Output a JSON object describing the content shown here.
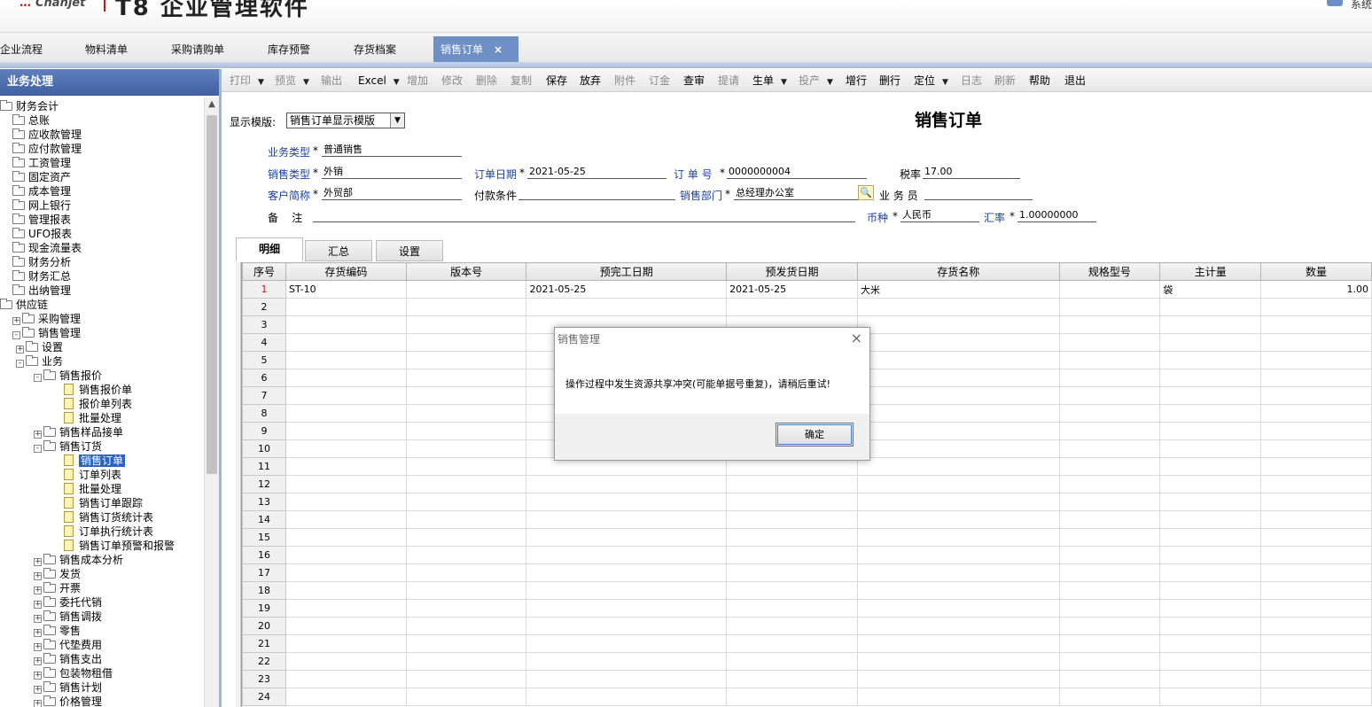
{
  "header": {
    "brand_prefix": "…",
    "brand": "Chanjet",
    "title": "T8 企业管理软件",
    "user_text": "系统"
  },
  "tabs": [
    {
      "label": "企业流程"
    },
    {
      "label": "物料清单"
    },
    {
      "label": "采购请购单"
    },
    {
      "label": "库存预警"
    },
    {
      "label": "存货档案"
    },
    {
      "label": "销售订单",
      "active": true,
      "close": "×"
    }
  ],
  "left_panel": {
    "title": "业务处理",
    "tree": [
      {
        "label": "财务会计",
        "level": 0,
        "exp": "",
        "icon": "folder"
      },
      {
        "label": "总账",
        "level": 1,
        "exp": "",
        "icon": "folder"
      },
      {
        "label": "应收款管理",
        "level": 1,
        "exp": "",
        "icon": "folder"
      },
      {
        "label": "应付款管理",
        "level": 1,
        "exp": "",
        "icon": "folder"
      },
      {
        "label": "工资管理",
        "level": 1,
        "exp": "",
        "icon": "folder"
      },
      {
        "label": "固定资产",
        "level": 1,
        "exp": "",
        "icon": "folder"
      },
      {
        "label": "成本管理",
        "level": 1,
        "exp": "",
        "icon": "folder"
      },
      {
        "label": "网上银行",
        "level": 1,
        "exp": "",
        "icon": "folder"
      },
      {
        "label": "管理报表",
        "level": 1,
        "exp": "",
        "icon": "folder"
      },
      {
        "label": "UFO报表",
        "level": 1,
        "exp": "",
        "icon": "folder"
      },
      {
        "label": "现金流量表",
        "level": 1,
        "exp": "",
        "icon": "folder"
      },
      {
        "label": "财务分析",
        "level": 1,
        "exp": "",
        "icon": "folder"
      },
      {
        "label": "财务汇总",
        "level": 1,
        "exp": "",
        "icon": "folder"
      },
      {
        "label": "出纳管理",
        "level": 1,
        "exp": "",
        "icon": "folder"
      },
      {
        "label": "供应链",
        "level": 0,
        "exp": "",
        "icon": "folder"
      },
      {
        "label": "采购管理",
        "level": 1,
        "exp": "+",
        "icon": "folder"
      },
      {
        "label": "销售管理",
        "level": 1,
        "exp": "-",
        "icon": "folder"
      },
      {
        "label": "设置",
        "level": 2,
        "exp": "+",
        "icon": "folder"
      },
      {
        "label": "业务",
        "level": 2,
        "exp": "-",
        "icon": "folder"
      },
      {
        "label": "销售报价",
        "level": 3,
        "exp": "-",
        "icon": "folder"
      },
      {
        "label": "销售报价单",
        "level": 4,
        "exp": "",
        "icon": "doc"
      },
      {
        "label": "报价单列表",
        "level": 4,
        "exp": "",
        "icon": "doc"
      },
      {
        "label": "批量处理",
        "level": 4,
        "exp": "",
        "icon": "doc"
      },
      {
        "label": "销售样品接单",
        "level": 3,
        "exp": "+",
        "icon": "folder"
      },
      {
        "label": "销售订货",
        "level": 3,
        "exp": "-",
        "icon": "folder"
      },
      {
        "label": "销售订单",
        "level": 4,
        "exp": "",
        "icon": "doc",
        "selected": true
      },
      {
        "label": "订单列表",
        "level": 4,
        "exp": "",
        "icon": "doc"
      },
      {
        "label": "批量处理",
        "level": 4,
        "exp": "",
        "icon": "doc"
      },
      {
        "label": "销售订单跟踪",
        "level": 4,
        "exp": "",
        "icon": "doc"
      },
      {
        "label": "销售订货统计表",
        "level": 4,
        "exp": "",
        "icon": "doc"
      },
      {
        "label": "订单执行统计表",
        "level": 4,
        "exp": "",
        "icon": "doc"
      },
      {
        "label": "销售订单预警和报警",
        "level": 4,
        "exp": "",
        "icon": "doc"
      },
      {
        "label": "销售成本分析",
        "level": 3,
        "exp": "+",
        "icon": "folder"
      },
      {
        "label": "发货",
        "level": 3,
        "exp": "+",
        "icon": "folder"
      },
      {
        "label": "开票",
        "level": 3,
        "exp": "+",
        "icon": "folder"
      },
      {
        "label": "委托代销",
        "level": 3,
        "exp": "+",
        "icon": "folder"
      },
      {
        "label": "销售调拨",
        "level": 3,
        "exp": "+",
        "icon": "folder"
      },
      {
        "label": "零售",
        "level": 3,
        "exp": "+",
        "icon": "folder"
      },
      {
        "label": "代垫费用",
        "level": 3,
        "exp": "+",
        "icon": "folder"
      },
      {
        "label": "销售支出",
        "level": 3,
        "exp": "+",
        "icon": "folder"
      },
      {
        "label": "包装物租借",
        "level": 3,
        "exp": "+",
        "icon": "folder"
      },
      {
        "label": "销售计划",
        "level": 3,
        "exp": "+",
        "icon": "folder"
      },
      {
        "label": "价格管理",
        "level": 3,
        "exp": "+",
        "icon": "folder"
      }
    ]
  },
  "toolbar": [
    {
      "label": "打印",
      "disabled": true,
      "dd": true
    },
    {
      "label": "预览",
      "disabled": true,
      "dd": true
    },
    {
      "label": "输出",
      "disabled": true
    },
    {
      "label": "Excel",
      "disabled": false,
      "dd": true
    },
    {
      "label": "增加",
      "disabled": true
    },
    {
      "label": "修改",
      "disabled": true
    },
    {
      "label": "删除",
      "disabled": true
    },
    {
      "label": "复制",
      "disabled": true
    },
    {
      "label": "保存",
      "disabled": false
    },
    {
      "label": "放弃",
      "disabled": false
    },
    {
      "label": "附件",
      "disabled": true
    },
    {
      "label": "订金",
      "disabled": true
    },
    {
      "label": "查审",
      "disabled": false
    },
    {
      "label": "提请",
      "disabled": true
    },
    {
      "label": "生单",
      "disabled": false,
      "dd": true
    },
    {
      "label": "投产",
      "disabled": true,
      "dd": true
    },
    {
      "label": "增行",
      "disabled": false
    },
    {
      "label": "删行",
      "disabled": false
    },
    {
      "label": "定位",
      "disabled": false,
      "dd": true
    },
    {
      "label": "日志",
      "disabled": true
    },
    {
      "label": "刷新",
      "disabled": true
    },
    {
      "label": "帮助",
      "disabled": false
    },
    {
      "label": "退出",
      "disabled": false
    }
  ],
  "form": {
    "template_label": "显示模版:",
    "template_value": "销售订单显示模版",
    "doc_title": "销售订单",
    "required_mark": "*",
    "biz_type_label": "业务类型",
    "biz_type_value": "普通销售",
    "sale_type_label": "销售类型",
    "sale_type_value": "外销",
    "order_date_label": "订单日期",
    "order_date_value": "2021-05-25",
    "order_no_label": "订 单 号",
    "order_no_value": "0000000004",
    "tax_label": "税率",
    "tax_value": "17.00",
    "customer_label": "客户简称",
    "customer_value": "外贸部",
    "payment_label": "付款条件",
    "payment_value": "",
    "dept_label": "销售部门",
    "dept_value": "总经理办公室",
    "salesman_label": "业 务 员",
    "salesman_value": "",
    "remark_label": "备    注",
    "remark_value": "",
    "currency_label": "币种",
    "currency_value": "人民币",
    "rate_label": "汇率",
    "rate_value": "1.00000000"
  },
  "detail_tabs": [
    {
      "label": "明细",
      "active": true
    },
    {
      "label": "汇总"
    },
    {
      "label": "设置"
    }
  ],
  "grid": {
    "columns": [
      "序号",
      "存货编码",
      "版本号",
      "预完工日期",
      "预发货日期",
      "存货名称",
      "规格型号",
      "主计量",
      "数量"
    ],
    "rows": [
      {
        "no": "1",
        "code": "ST-10",
        "version": "",
        "finish_date": "2021-05-25",
        "ship_date": "2021-05-25",
        "name": "大米",
        "spec": "",
        "unit": "袋",
        "qty": "1.00"
      },
      {
        "no": "2"
      },
      {
        "no": "3"
      },
      {
        "no": "4"
      },
      {
        "no": "5"
      },
      {
        "no": "6"
      },
      {
        "no": "7"
      },
      {
        "no": "8"
      },
      {
        "no": "9"
      },
      {
        "no": "10"
      },
      {
        "no": "11"
      },
      {
        "no": "12"
      },
      {
        "no": "13"
      },
      {
        "no": "14"
      },
      {
        "no": "15"
      },
      {
        "no": "16"
      },
      {
        "no": "17"
      },
      {
        "no": "18"
      },
      {
        "no": "19"
      },
      {
        "no": "20"
      },
      {
        "no": "21"
      },
      {
        "no": "22"
      },
      {
        "no": "23"
      },
      {
        "no": "24"
      }
    ]
  },
  "dialog": {
    "title": "销售管理",
    "close": "×",
    "message": "操作过程中发生资源共享冲突(可能单据号重复)，请稍后重试!",
    "ok_label": "确定"
  }
}
